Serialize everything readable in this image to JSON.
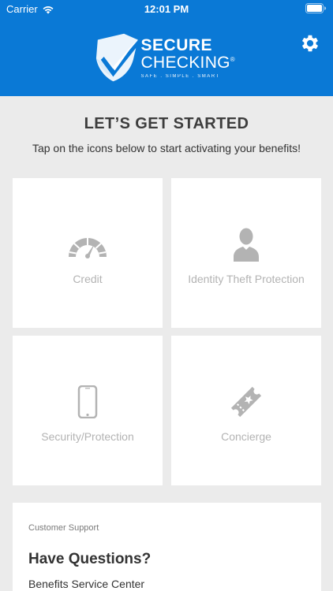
{
  "status_bar": {
    "carrier": "Carrier",
    "time": "12:01 PM",
    "wifi_icon": "wifi-icon",
    "battery_icon": "battery-icon"
  },
  "header": {
    "logo": {
      "line1": "SECURE",
      "line2": "CHECKING",
      "registered": "®",
      "tagline": "SAFE . SIMPLE . SMART"
    },
    "settings_icon": "gear-icon",
    "brand_color": "#0a79d6"
  },
  "intro": {
    "title": "LET’S GET STARTED",
    "subtitle": "Tap on the icons below to start activating your benefits!"
  },
  "benefits": [
    {
      "label": "Credit",
      "icon": "speedometer-icon"
    },
    {
      "label": "Identity Theft Protection",
      "icon": "person-icon"
    },
    {
      "label": "Security/Protection",
      "icon": "phone-icon"
    },
    {
      "label": "Concierge",
      "icon": "ticket-icon"
    }
  ],
  "support": {
    "caption": "Customer Support",
    "heading": "Have Questions?",
    "center": "Benefits Service Center"
  },
  "colors": {
    "icon_gray": "#b3b3b3",
    "background": "#ebebeb"
  }
}
